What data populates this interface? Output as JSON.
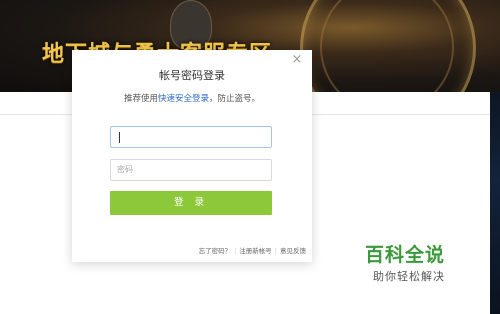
{
  "banner": {
    "title": "地下城与勇士客服专区"
  },
  "modal": {
    "close_symbol": "×",
    "title": "帐号密码登录",
    "subtitle_prefix": "推荐使用",
    "subtitle_link": "快速安全登录",
    "subtitle_suffix": "，防止盗号。",
    "username_value": "",
    "password_placeholder": "密码",
    "login_label": "登 录",
    "links": {
      "forgot": "忘了密码？",
      "register": "注册新帐号",
      "feedback": "意见反馈"
    },
    "separator": "|"
  },
  "watermark": {
    "title": "百科全说",
    "subtitle": "助你轻松解决"
  },
  "colors": {
    "login_button": "#8cc83a",
    "link": "#2a6ac8",
    "watermark": "#3a9a3a",
    "banner_title": "#f1c84a"
  }
}
